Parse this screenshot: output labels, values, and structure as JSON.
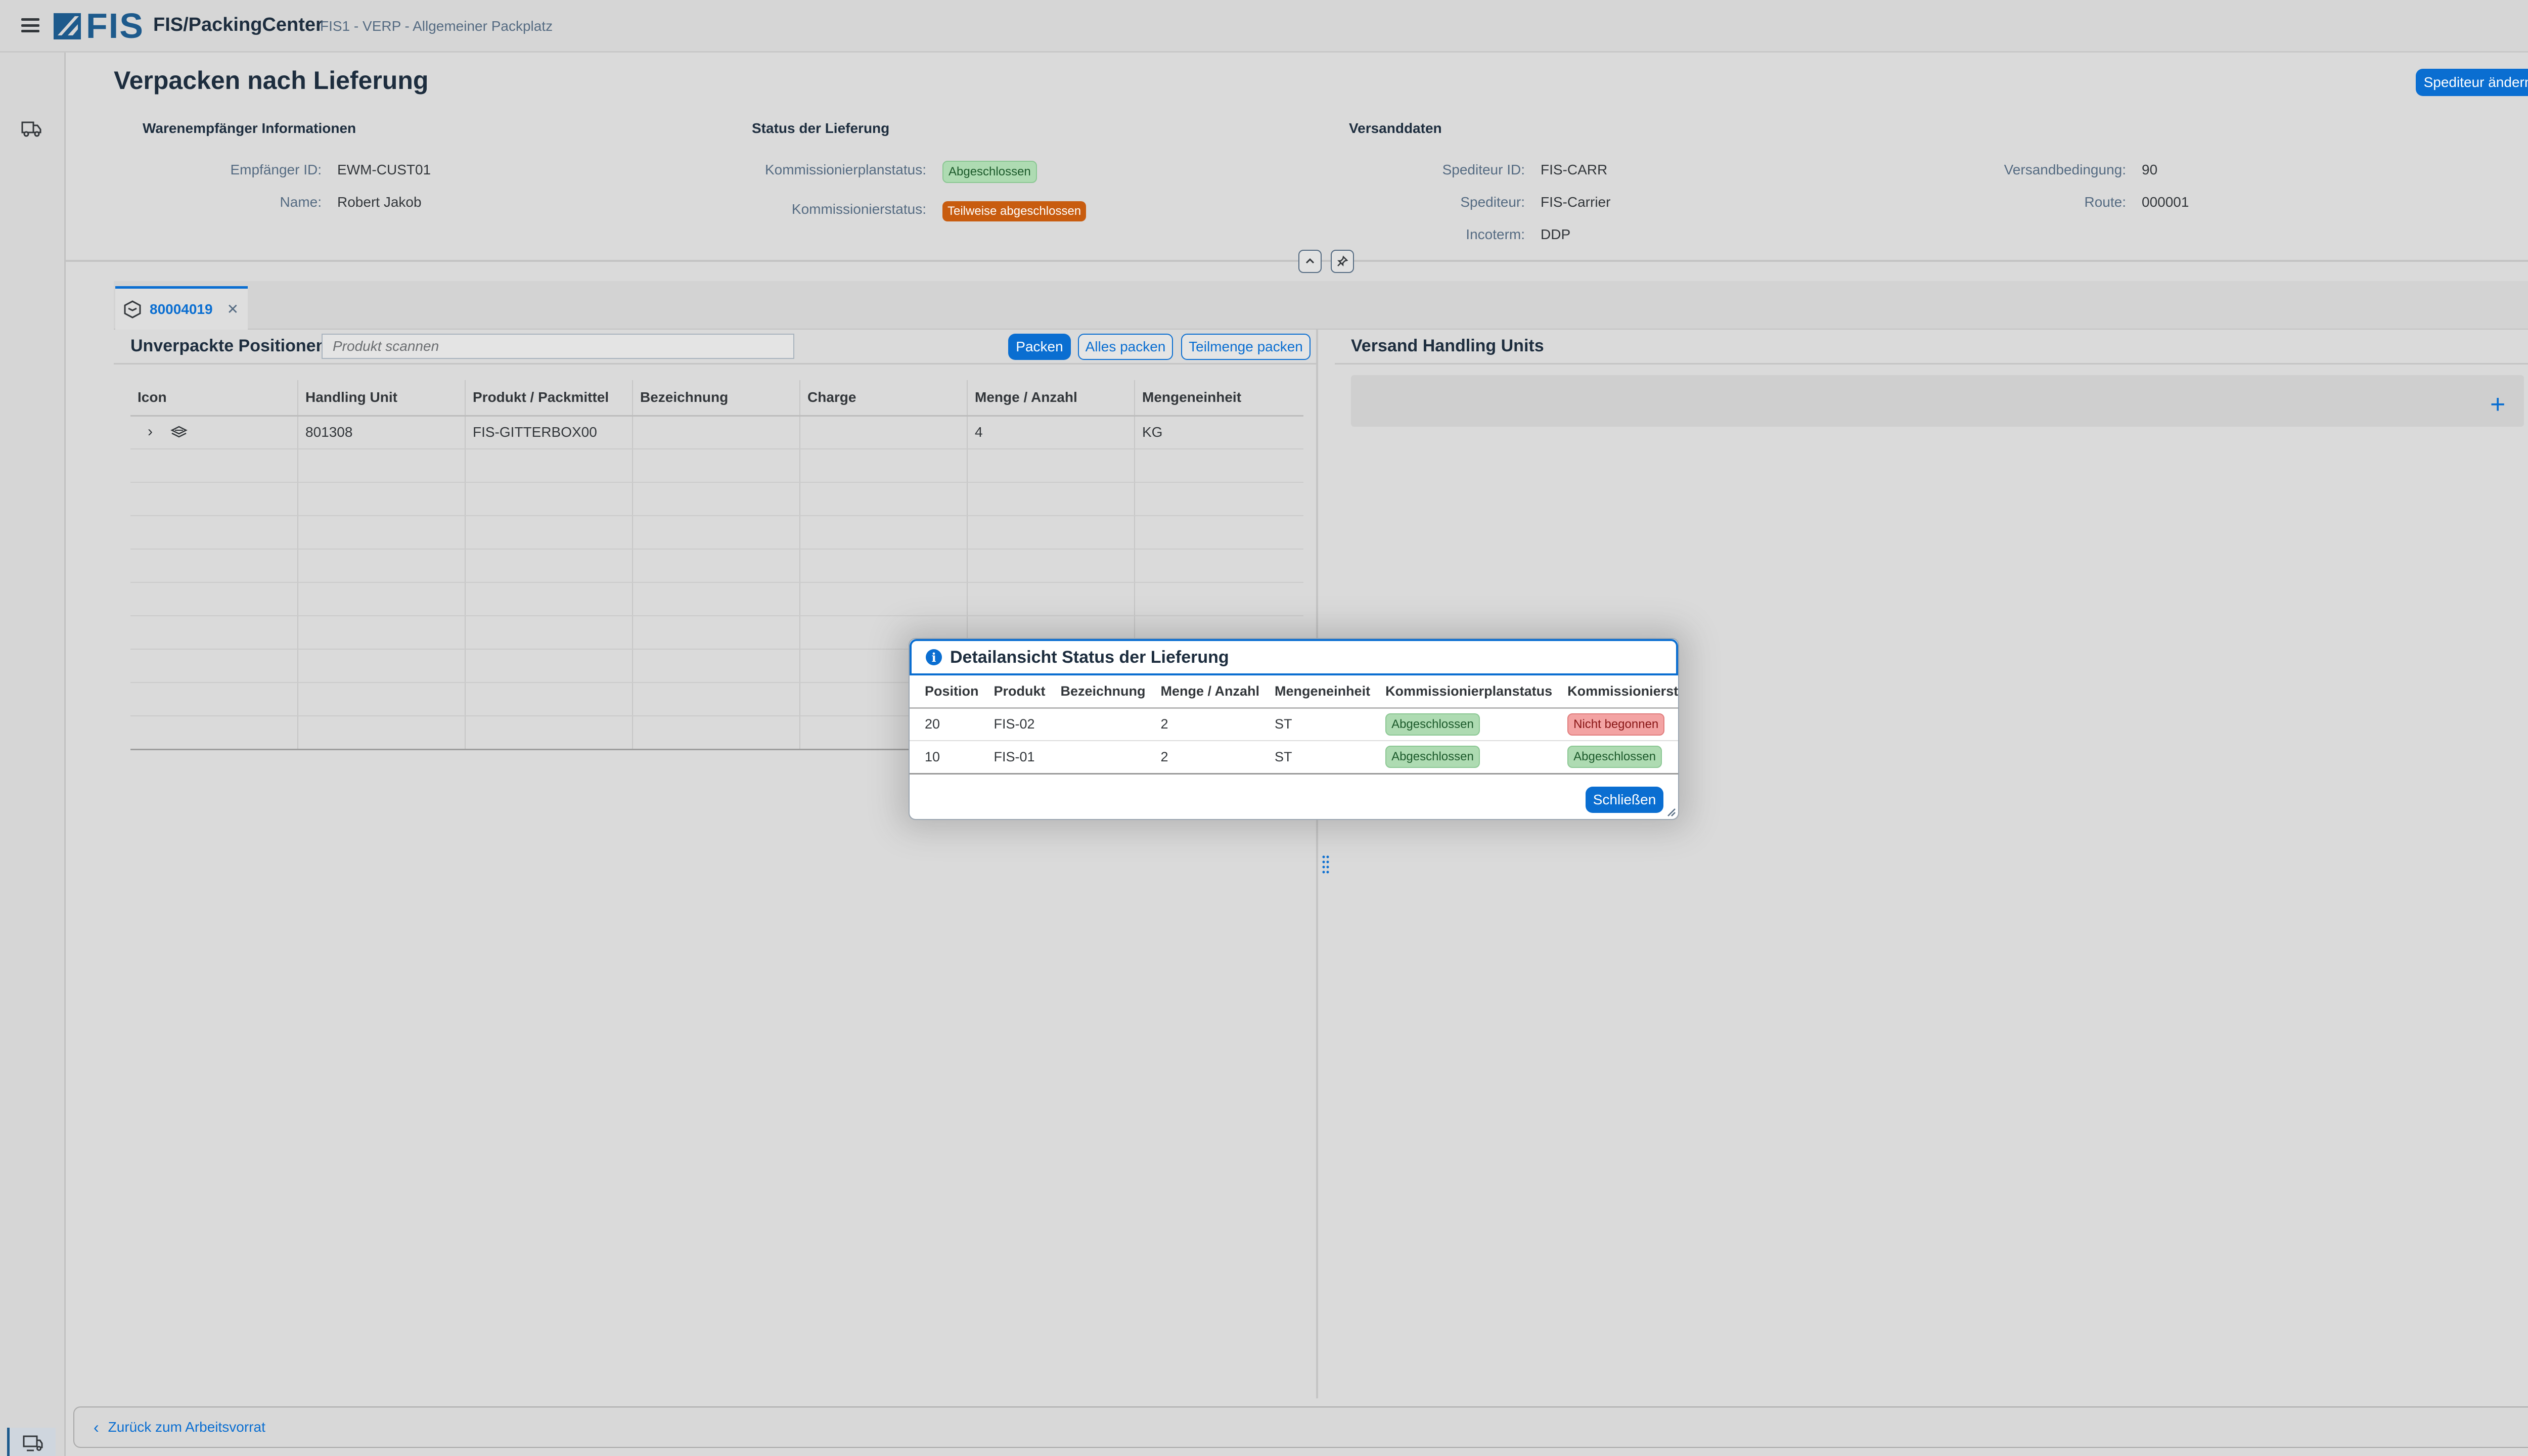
{
  "shell": {
    "logo_text": "FIS",
    "app_title": "FIS/PackingCenter",
    "app_subtitle": "FIS1 - VERP - Allgemeiner Packplatz",
    "menu_icon": "hamburger-icon"
  },
  "sidebar": {
    "items": [
      {
        "icon": "truck-icon"
      }
    ],
    "bottom_items": [
      {
        "icon": "truck-monitor-icon",
        "active": true
      },
      {
        "icon": "settings-gears-icon"
      }
    ]
  },
  "page": {
    "title": "Verpacken nach Lieferung",
    "change_carrier_button": "Spediteur ändern",
    "recipient": {
      "title": "Warenempfänger Informationen",
      "fields": [
        {
          "label": "Empfänger ID:",
          "value": "EWM-CUST01"
        },
        {
          "label": "Name:",
          "value": "Robert Jakob"
        }
      ]
    },
    "delivery_status": {
      "title": "Status der Lieferung",
      "fields": [
        {
          "label": "Kommissionierplanstatus:",
          "value": "Abgeschlossen",
          "color": "#aedbb2"
        },
        {
          "label": "Kommissionierstatus:",
          "value": "Teilweise abgeschlossen",
          "color": "#c85c0f"
        }
      ]
    },
    "shipping": {
      "title": "Versanddaten",
      "left": [
        {
          "label": "Spediteur ID:",
          "value": "FIS-CARR"
        },
        {
          "label": "Spediteur:",
          "value": "FIS-Carrier"
        },
        {
          "label": "Incoterm:",
          "value": "DDP"
        }
      ],
      "right": [
        {
          "label": "Versandbedingung:",
          "value": "90"
        },
        {
          "label": "Route:",
          "value": "000001"
        }
      ]
    }
  },
  "tabs": [
    {
      "label": "80004019",
      "icon": "package-icon",
      "closable": true
    }
  ],
  "unpacked": {
    "title": "Unverpackte Positionen",
    "search_placeholder": "Produkt scannen",
    "buttons": {
      "pack": "Packen",
      "pack_all": "Alles packen",
      "pack_partial": "Teilmenge packen"
    },
    "columns": [
      "Icon",
      "Handling Unit",
      "Produkt / Packmittel",
      "Bezeichnung",
      "Charge",
      "Menge / Anzahl",
      "Mengeneinheit"
    ],
    "rows": [
      {
        "icon": "layers-icon",
        "handling_unit": "801308",
        "product": "FIS-GITTERBOX00",
        "description": "",
        "batch": "",
        "quantity": "4",
        "unit": "KG"
      }
    ]
  },
  "shipping_hu": {
    "title": "Versand Handling Units",
    "add_icon": "plus-icon"
  },
  "footer": {
    "back_label": "Zurück zum Arbeitsvorrat"
  },
  "dialog": {
    "title": "Detailansicht Status der Lieferung",
    "columns": [
      "Position",
      "Produkt",
      "Bezeichnung",
      "Menge / Anzahl",
      "Mengeneinheit",
      "Kommissionierplanstatus",
      "Kommissionierstatus"
    ],
    "rows": [
      {
        "position": "20",
        "product": "FIS-02",
        "description": "",
        "quantity": "2",
        "unit": "ST",
        "plan_status": "Abgeschlossen",
        "status": "Nicht begonnen"
      },
      {
        "position": "10",
        "product": "FIS-01",
        "description": "",
        "quantity": "2",
        "unit": "ST",
        "plan_status": "Abgeschlossen",
        "status": "Abgeschlossen"
      }
    ],
    "close_button": "Schließen"
  }
}
